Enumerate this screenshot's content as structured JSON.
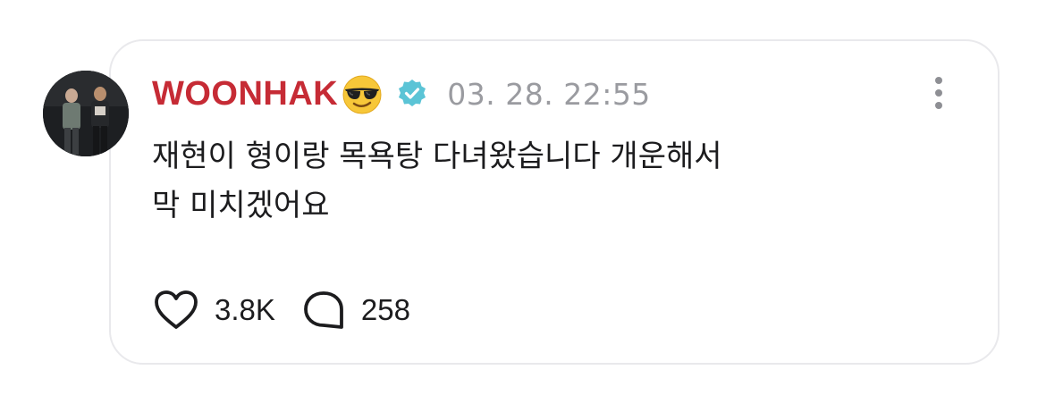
{
  "post": {
    "author": "WOONHAK",
    "author_emoji": "smiling-face-with-sunglasses",
    "verified_icon": "verified-badge-icon",
    "timestamp": "03. 28. 22:55",
    "body_lines": [
      "재현이 형이랑 목욕탕 다녀왔습니다 개운해서",
      "막 미치겠어요"
    ],
    "likes_count": "3.8K",
    "comments_count": "258",
    "icons": {
      "like": "heart-outline-icon",
      "comment": "speech-bubble-icon",
      "more": "more-vertical-icon"
    }
  },
  "colors": {
    "author": "#c62b35",
    "timestamp": "#9a9ba0",
    "verified": "#5bc4d6",
    "border": "#e9e9ec",
    "text": "#1c1c1e"
  }
}
